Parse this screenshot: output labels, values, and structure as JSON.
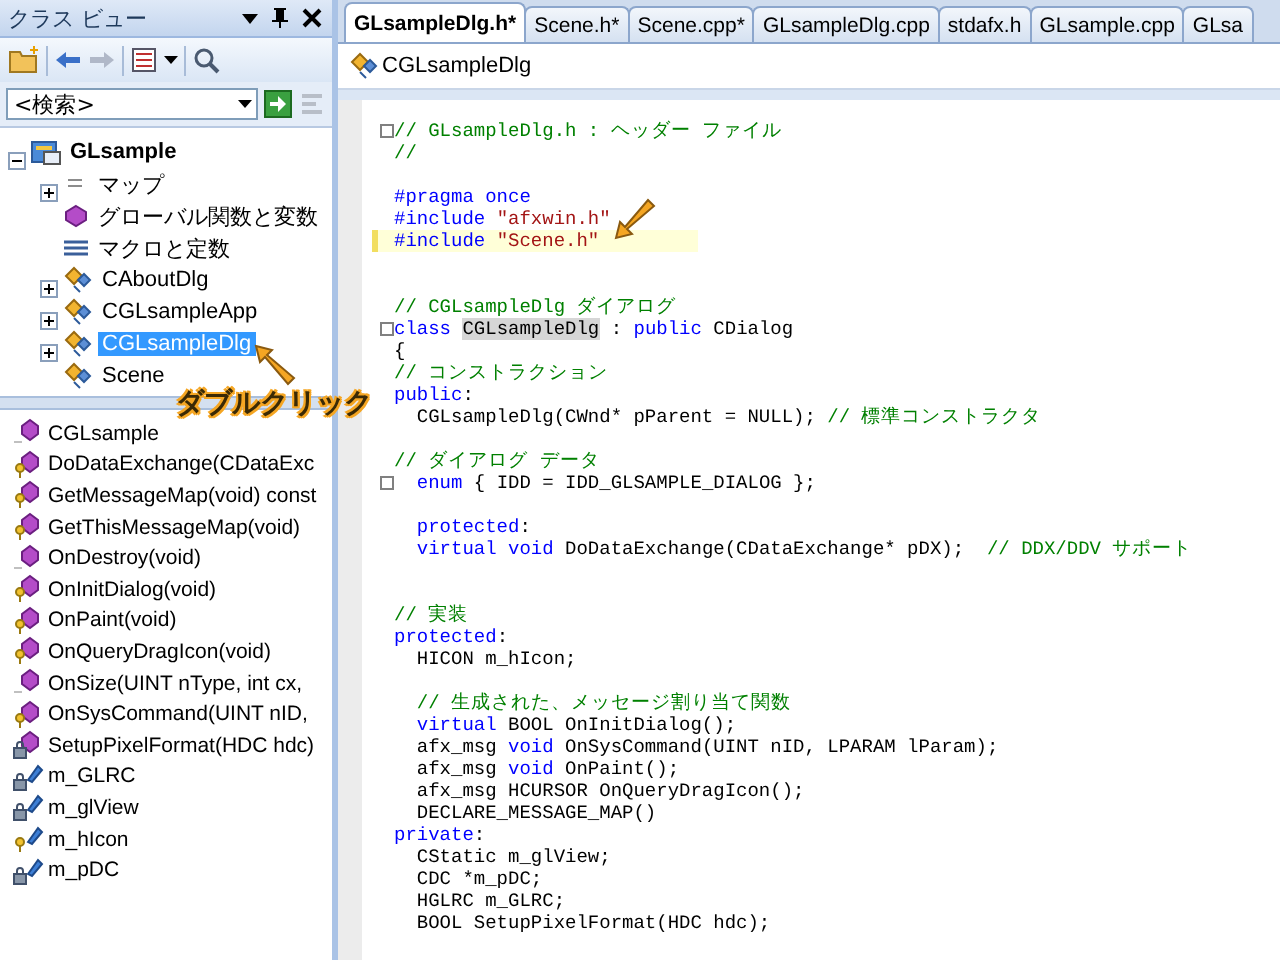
{
  "class_view": {
    "title": "クラス ビュー",
    "search": {
      "placeholder": "<検索>"
    },
    "tree": [
      {
        "label": "GLsample",
        "kind": "project",
        "expandable": true,
        "expanded": true,
        "selected": false,
        "children": [
          {
            "label": "マップ",
            "kind": "map",
            "expandable": true,
            "expanded": false,
            "selected": false
          },
          {
            "label": "グローバル関数と変数",
            "kind": "globals",
            "expandable": false,
            "expanded": false,
            "selected": false
          },
          {
            "label": "マクロと定数",
            "kind": "macros",
            "expandable": false,
            "expanded": false,
            "selected": false
          },
          {
            "label": "CAboutDlg",
            "kind": "class",
            "expandable": true,
            "expanded": false,
            "selected": false
          },
          {
            "label": "CGLsampleApp",
            "kind": "class",
            "expandable": true,
            "expanded": false,
            "selected": false
          },
          {
            "label": "CGLsampleDlg",
            "kind": "class",
            "expandable": true,
            "expanded": false,
            "selected": true
          },
          {
            "label": "Scene",
            "kind": "class",
            "expandable": false,
            "expanded": false,
            "selected": false
          }
        ]
      }
    ],
    "members": [
      {
        "label": "CGLsample",
        "kind": "public_method"
      },
      {
        "label": "DoDataExchange(CDataExc",
        "kind": "protected_method"
      },
      {
        "label": "GetMessageMap(void) const",
        "kind": "protected_method"
      },
      {
        "label": "GetThisMessageMap(void)",
        "kind": "protected_method"
      },
      {
        "label": "OnDestroy(void)",
        "kind": "public_method"
      },
      {
        "label": "OnInitDialog(void)",
        "kind": "protected_method"
      },
      {
        "label": "OnPaint(void)",
        "kind": "protected_method"
      },
      {
        "label": "OnQueryDragIcon(void)",
        "kind": "protected_method"
      },
      {
        "label": "OnSize(UINT nType, int cx,",
        "kind": "public_method"
      },
      {
        "label": "OnSysCommand(UINT nID,",
        "kind": "protected_method"
      },
      {
        "label": "SetupPixelFormat(HDC hdc)",
        "kind": "private_method"
      },
      {
        "label": "m_GLRC",
        "kind": "private_field"
      },
      {
        "label": "m_glView",
        "kind": "private_field"
      },
      {
        "label": "m_hIcon",
        "kind": "protected_field"
      },
      {
        "label": "m_pDC",
        "kind": "private_field"
      }
    ]
  },
  "editor": {
    "tabs": [
      {
        "label": "GLsampleDlg.h*",
        "selected": true
      },
      {
        "label": "Scene.h*",
        "selected": false
      },
      {
        "label": "Scene.cpp*",
        "selected": false
      },
      {
        "label": "GLsampleDlg.cpp",
        "selected": false
      },
      {
        "label": "stdafx.h",
        "selected": false
      },
      {
        "label": "GLsample.cpp",
        "selected": false
      },
      {
        "label": "GLsa",
        "selected": false
      }
    ],
    "nav_class": "CGLsampleDlg",
    "lines": [
      {
        "current": false,
        "fold": true,
        "tokens": [
          {
            "kind": "comment",
            "text": "// GLsampleDlg.h : ヘッダー ファイル"
          }
        ]
      },
      {
        "current": false,
        "fold": false,
        "tokens": [
          {
            "kind": "comment",
            "text": "//"
          }
        ]
      },
      {
        "current": false,
        "fold": false
      },
      {
        "current": false,
        "fold": false,
        "tokens": [
          {
            "kind": "keyword",
            "text": "#pragma once"
          }
        ]
      },
      {
        "current": false,
        "fold": false,
        "tokens": [
          {
            "kind": "keyword",
            "text": "#include "
          },
          {
            "kind": "string",
            "text": "\"afxwin.h\""
          }
        ]
      },
      {
        "current": true,
        "fold": false,
        "tokens": [
          {
            "kind": "keyword",
            "text": "#include "
          },
          {
            "kind": "string",
            "text": "\"Scene.h\""
          }
        ]
      },
      {
        "current": false,
        "fold": false
      },
      {
        "current": false,
        "fold": false
      },
      {
        "current": false,
        "fold": false,
        "tokens": [
          {
            "kind": "comment",
            "text": "// CGLsampleDlg ダイアログ"
          }
        ]
      },
      {
        "current": false,
        "fold": true,
        "tokens": [
          {
            "kind": "keyword",
            "text": "class "
          },
          {
            "kind": "reference",
            "text": "CGLsampleDlg"
          },
          {
            "kind": "plain",
            "text": " : "
          },
          {
            "kind": "keyword",
            "text": "public"
          },
          {
            "kind": "plain",
            "text": " CDialog"
          }
        ]
      },
      {
        "current": false,
        "fold": false,
        "tokens": [
          {
            "kind": "plain",
            "text": "{"
          }
        ]
      },
      {
        "current": false,
        "fold": false,
        "tokens": [
          {
            "kind": "comment",
            "text": "// コンストラクション"
          }
        ]
      },
      {
        "current": false,
        "fold": false,
        "tokens": [
          {
            "kind": "keyword",
            "text": "public"
          },
          {
            "kind": "plain",
            "text": ":"
          }
        ]
      },
      {
        "current": false,
        "fold": false,
        "tokens": [
          {
            "kind": "plain",
            "text": "  CGLsampleDlg(CWnd* pParent = NULL); "
          },
          {
            "kind": "comment",
            "text": "// 標準コンストラクタ"
          }
        ]
      },
      {
        "current": false,
        "fold": false
      },
      {
        "current": false,
        "fold": false,
        "tokens": [
          {
            "kind": "comment",
            "text": "// ダイアログ データ"
          }
        ]
      },
      {
        "current": false,
        "fold": true,
        "tokens": [
          {
            "kind": "keyword",
            "text": "  enum"
          },
          {
            "kind": "plain",
            "text": " { IDD = IDD_GLSAMPLE_DIALOG };"
          }
        ]
      },
      {
        "current": false,
        "fold": false
      },
      {
        "current": false,
        "fold": false,
        "tokens": [
          {
            "kind": "keyword",
            "text": "  protected"
          },
          {
            "kind": "plain",
            "text": ":"
          }
        ]
      },
      {
        "current": false,
        "fold": false,
        "tokens": [
          {
            "kind": "keyword",
            "text": "  virtual void"
          },
          {
            "kind": "plain",
            "text": " DoDataExchange(CDataExchange* pDX);  "
          },
          {
            "kind": "comment",
            "text": "// DDX/DDV サポート"
          }
        ]
      },
      {
        "current": false,
        "fold": false
      },
      {
        "current": false,
        "fold": false
      },
      {
        "current": false,
        "fold": false,
        "tokens": [
          {
            "kind": "comment",
            "text": "// 実装"
          }
        ]
      },
      {
        "current": false,
        "fold": false,
        "tokens": [
          {
            "kind": "keyword",
            "text": "protected"
          },
          {
            "kind": "plain",
            "text": ":"
          }
        ]
      },
      {
        "current": false,
        "fold": false,
        "tokens": [
          {
            "kind": "plain",
            "text": "  HICON m_hIcon;"
          }
        ]
      },
      {
        "current": false,
        "fold": false
      },
      {
        "current": false,
        "fold": false,
        "tokens": [
          {
            "kind": "comment",
            "text": "  // 生成された、メッセージ割り当て関数"
          }
        ]
      },
      {
        "current": false,
        "fold": false,
        "tokens": [
          {
            "kind": "keyword",
            "text": "  virtual"
          },
          {
            "kind": "plain",
            "text": " BOOL OnInitDialog();"
          }
        ]
      },
      {
        "current": false,
        "fold": false,
        "tokens": [
          {
            "kind": "plain",
            "text": "  afx_msg "
          },
          {
            "kind": "keyword",
            "text": "void"
          },
          {
            "kind": "plain",
            "text": " OnSysCommand(UINT nID, LPARAM lParam);"
          }
        ]
      },
      {
        "current": false,
        "fold": false,
        "tokens": [
          {
            "kind": "plain",
            "text": "  afx_msg "
          },
          {
            "kind": "keyword",
            "text": "void"
          },
          {
            "kind": "plain",
            "text": " OnPaint();"
          }
        ]
      },
      {
        "current": false,
        "fold": false,
        "tokens": [
          {
            "kind": "plain",
            "text": "  afx_msg HCURSOR OnQueryDragIcon();"
          }
        ]
      },
      {
        "current": false,
        "fold": false,
        "tokens": [
          {
            "kind": "plain",
            "text": "  DECLARE_MESSAGE_MAP()"
          }
        ]
      },
      {
        "current": false,
        "fold": false,
        "tokens": [
          {
            "kind": "keyword",
            "text": "private"
          },
          {
            "kind": "plain",
            "text": ":"
          }
        ]
      },
      {
        "current": false,
        "fold": false,
        "tokens": [
          {
            "kind": "plain",
            "text": "  CStatic m_glView;"
          }
        ]
      },
      {
        "current": false,
        "fold": false,
        "tokens": [
          {
            "kind": "plain",
            "text": "  CDC *m_pDC;"
          }
        ]
      },
      {
        "current": false,
        "fold": false,
        "tokens": [
          {
            "kind": "plain",
            "text": "  HGLRC m_GLRC;"
          }
        ]
      },
      {
        "current": false,
        "fold": false,
        "tokens": [
          {
            "kind": "plain",
            "text": "  BOOL SetupPixelFormat(HDC hdc);"
          }
        ]
      }
    ]
  },
  "annotation": {
    "text": "ダブルクリック"
  }
}
